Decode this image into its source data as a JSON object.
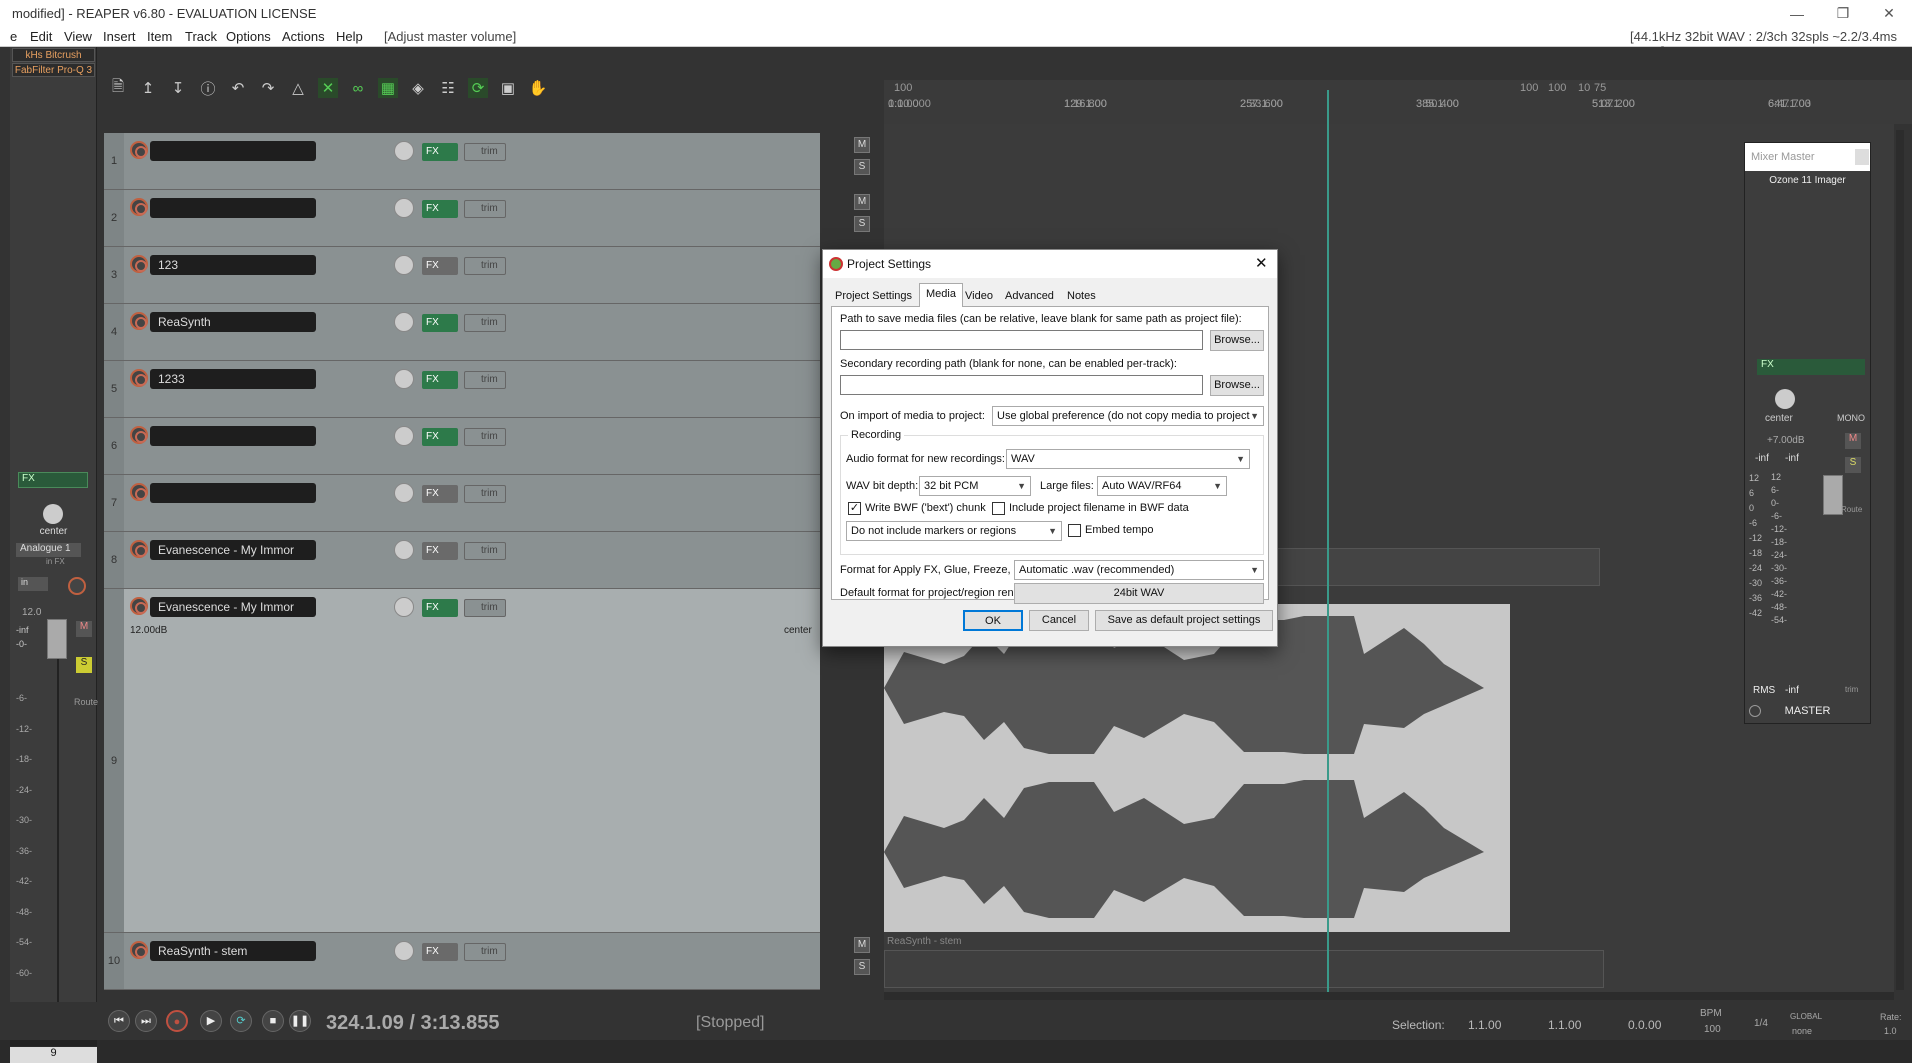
{
  "window": {
    "title": "modified] - REAPER v6.80 - EVALUATION LICENSE",
    "status_right": "[44.1kHz 32bit WAV : 2/3ch 32spls ~2.2/3.4ms ASIO]"
  },
  "menu": {
    "items": [
      "e",
      "Edit",
      "View",
      "Insert",
      "Item",
      "Track",
      "Options",
      "Actions",
      "Help"
    ],
    "hint": "[Adjust master volume]"
  },
  "left_panel": {
    "fx_slots": [
      "kHs Bitcrush",
      "FabFilter Pro-Q 3"
    ],
    "fx_label": "FX",
    "pan_label": "center",
    "input_label": "Analogue 1",
    "in_fx": "in FX",
    "in_label": "in",
    "vol_top": "12.0",
    "neg_inf": "-inf",
    "zero": "-0-",
    "scale": [
      "-6-",
      "-12-",
      "-18-",
      "-24-",
      "-30-",
      "-36-",
      "-42-",
      "-48-",
      "-54-",
      "-60-"
    ],
    "route_label": "Route",
    "trim_label": "trim",
    "track_name": "Evanescence -",
    "track_num": "9",
    "m_label": "M",
    "s_label": "S"
  },
  "tracks": [
    {
      "num": "1",
      "name": "",
      "fx_active": true
    },
    {
      "num": "2",
      "name": "",
      "fx_active": true
    },
    {
      "num": "3",
      "name": "123",
      "fx_active": false
    },
    {
      "num": "4",
      "name": "ReaSynth",
      "fx_active": true
    },
    {
      "num": "5",
      "name": "1233",
      "fx_active": true
    },
    {
      "num": "6",
      "name": "",
      "fx_active": true
    },
    {
      "num": "7",
      "name": "",
      "fx_active": false
    },
    {
      "num": "8",
      "name": "Evanescence - My Immor",
      "fx_active": false
    },
    {
      "num": "9",
      "name": "Evanescence - My Immor",
      "fx_active": true,
      "vol": "12.00dB",
      "pan": "center"
    },
    {
      "num": "10",
      "name": "ReaSynth - stem",
      "fx_active": false
    }
  ],
  "track_labels": {
    "fx": "FX",
    "trim": "trim",
    "m": "M",
    "s": "S"
  },
  "ruler": {
    "top": [
      "100",
      "100",
      "100",
      "10",
      "75"
    ],
    "marks": [
      {
        "bar": "1.1.00",
        "time": "0:00.000"
      },
      {
        "bar": "129.1.00",
        "time": "1:16.800"
      },
      {
        "bar": "257.1.00",
        "time": "2:33.600"
      },
      {
        "bar": "385.1.00",
        "time": "3:50.400"
      },
      {
        "bar": "513.1.00",
        "time": "5:07.200"
      },
      {
        "bar": "641.1.00",
        "time": "6:47.703"
      }
    ]
  },
  "item_label": "ReaSynth - stem",
  "mixer": {
    "title": "Mixer Master",
    "plugin": "Ozone 11 Imager",
    "fx_label": "FX",
    "pan": "center",
    "mono": "MONO",
    "vol": "+7.00dB",
    "left_inf": "-inf",
    "right_inf": "-inf",
    "scale_left": [
      "12",
      "6",
      "0",
      "-6",
      "-12",
      "-18",
      "-24",
      "-30",
      "-36",
      "-42"
    ],
    "scale_mid": [
      "12",
      "6-",
      "0-",
      "-6-",
      "-12-",
      "-18-",
      "-24-",
      "-30-",
      "-36-",
      "-42-",
      "-48-",
      "-54-"
    ],
    "rms": "RMS",
    "rms_val": "-inf",
    "route": "Route",
    "trim": "trim",
    "name": "MASTER",
    "m": "M",
    "s": "S"
  },
  "transport": {
    "position": "324.1.09 / 3:13.855",
    "state": "[Stopped]",
    "selection_label": "Selection:",
    "sel_start": "1.1.00",
    "sel_end": "1.1.00",
    "sel_len": "0.0.00",
    "bpm_label": "BPM",
    "bpm": "100",
    "sig": "1/4",
    "global_label": "GLOBAL",
    "global_val": "none",
    "rate_label": "Rate:",
    "rate": "1.0"
  },
  "dialog": {
    "title": "Project Settings",
    "tabs": [
      "Project Settings",
      "Media",
      "Video",
      "Advanced",
      "Notes"
    ],
    "active_tab": "Media",
    "path_label": "Path to save media files (can be relative, leave blank for same path as project file):",
    "path_value": "",
    "browse": "Browse...",
    "secondary_label": "Secondary recording path (blank for none, can be enabled per-track):",
    "secondary_value": "",
    "import_label": "On import of media to project:",
    "import_value": "Use global preference (do not copy media to project",
    "recording_group": "Recording",
    "audio_format_label": "Audio format for new recordings:",
    "audio_format": "WAV",
    "wav_depth_label": "WAV bit depth:",
    "wav_depth": "32 bit PCM",
    "large_files_label": "Large files:",
    "large_files": "Auto WAV/RF64",
    "bwf_label": "Write BWF ('bext') chunk",
    "bwf_checked": true,
    "include_filename_label": "Include project filename in BWF data",
    "include_filename_checked": false,
    "markers_value": "Do not include markers or regions",
    "embed_tempo_label": "Embed tempo",
    "embed_tempo_checked": false,
    "apply_fx_label": "Format for Apply FX, Glue, Freeze, etc:",
    "apply_fx_value": "Automatic .wav (recommended)",
    "render_label": "Default format for project/region render:",
    "render_value": "24bit WAV",
    "ok": "OK",
    "cancel": "Cancel",
    "save_default": "Save as default project settings"
  }
}
